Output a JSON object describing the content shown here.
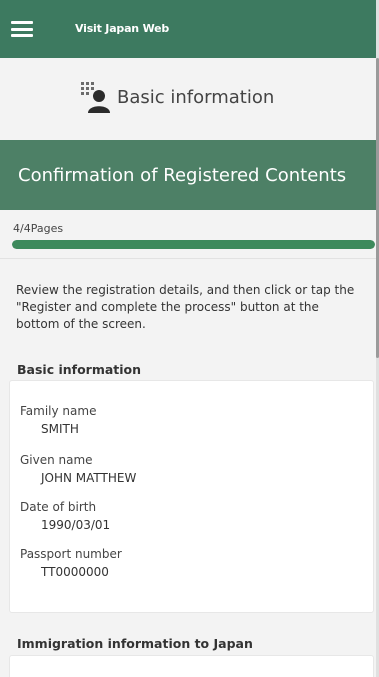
{
  "header": {
    "app_title": "Visit Japan Web",
    "menu_icon": "hamburger-menu-icon"
  },
  "section": {
    "title": "Basic information",
    "icon": "person-keypad-icon"
  },
  "banner": {
    "title": "Confirmation of Registered Contents"
  },
  "progress": {
    "label": "4/4Pages",
    "fraction": 1.0
  },
  "instructions": "Review the registration details, and then click or tap the \"Register and complete the process\" button at the bottom of the screen.",
  "basic_info": {
    "heading": "Basic information",
    "fields": [
      {
        "label": "Family name",
        "value": "SMITH"
      },
      {
        "label": "Given name",
        "value": "JOHN MATTHEW"
      },
      {
        "label": "Date of birth",
        "value": "1990/03/01"
      },
      {
        "label": "Passport number",
        "value": "TT0000000"
      }
    ]
  },
  "immigration": {
    "heading": "Immigration information to Japan"
  },
  "colors": {
    "header_green": "#3d7a60",
    "banner_green": "#4d8066",
    "progress_green": "#3d8a5c"
  }
}
